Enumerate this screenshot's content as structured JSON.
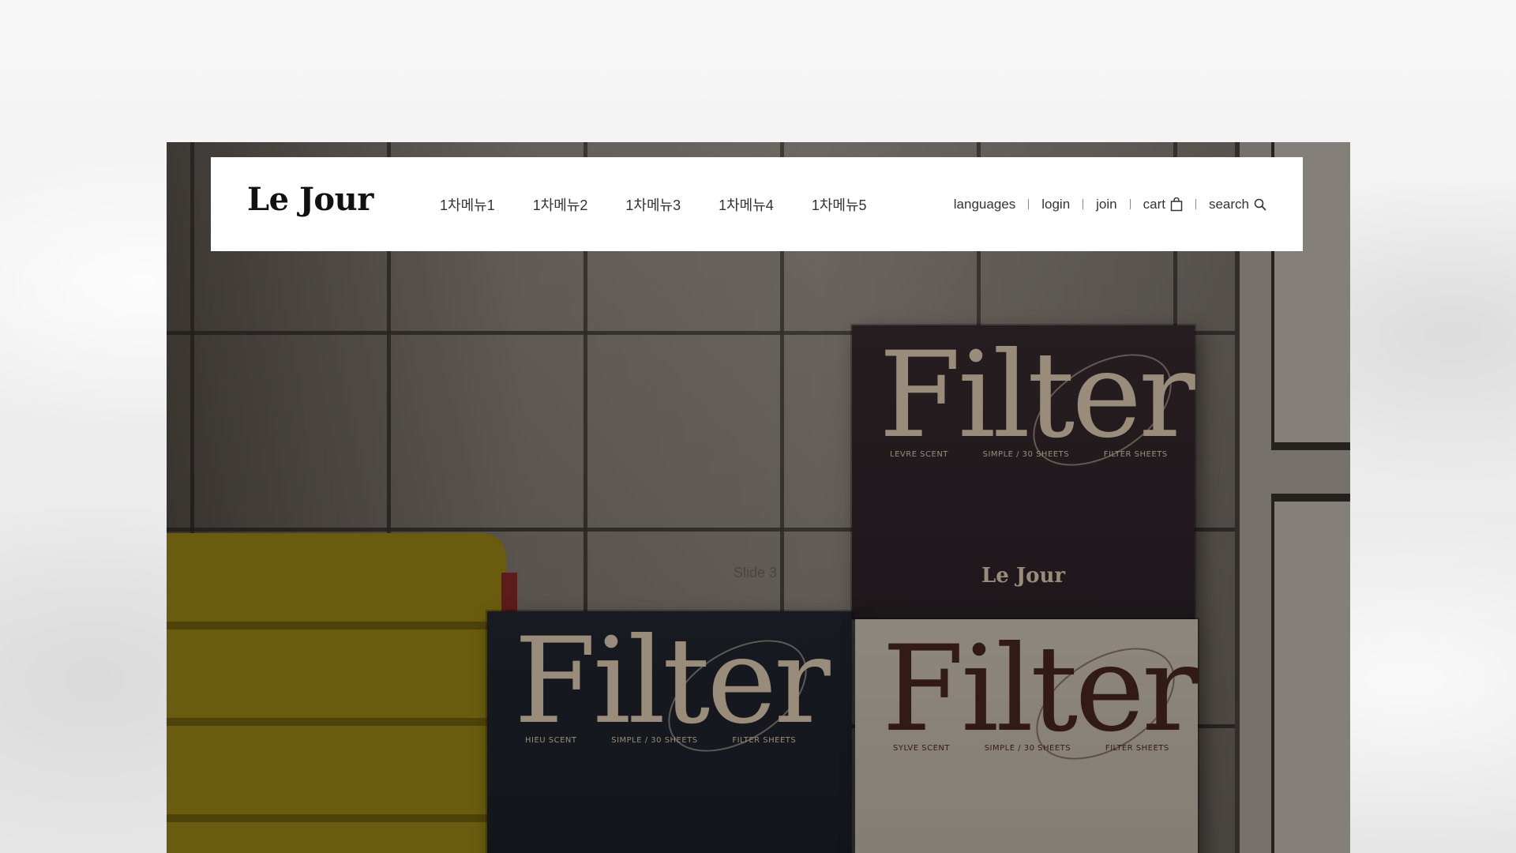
{
  "header": {
    "logo": "Le Jour",
    "menu": [
      {
        "label": "1차메뉴1"
      },
      {
        "label": "1차메뉴2"
      },
      {
        "label": "1차메뉴3"
      },
      {
        "label": "1차메뉴4"
      },
      {
        "label": "1차메뉴5"
      }
    ],
    "util": {
      "languages": "languages",
      "login": "login",
      "join": "join",
      "cart": "cart",
      "search": "search"
    },
    "icons": {
      "cart": "shopping-bag-icon",
      "search": "search-icon"
    }
  },
  "hero": {
    "slide_label": "Slide 3",
    "boxes": {
      "top": {
        "word": "Filter",
        "scent": "LEVRE SCENT",
        "sheets": "SIMPLE / 30 SHEETS",
        "type": "FILTER SHEETS",
        "brand": "Le Jour"
      },
      "navy": {
        "word": "Filter",
        "scent": "HIEU SCENT",
        "sheets": "SIMPLE / 30 SHEETS",
        "type": "FILTER SHEETS"
      },
      "light": {
        "word": "Filter",
        "scent": "SYLVE SCENT",
        "sheets": "SIMPLE / 30 SHEETS",
        "type": "FILTER SHEETS"
      }
    }
  },
  "colors": {
    "header_bg": "#ffffff",
    "text": "#333333",
    "logo": "#111111"
  }
}
